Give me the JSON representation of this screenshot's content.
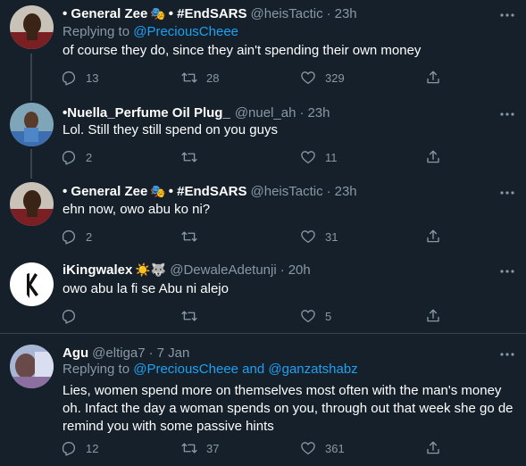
{
  "tweets": [
    {
      "name": "• General Zee",
      "emoji": "🎭",
      "name_suffix": "• #EndSARS",
      "handle": "@heisTactic",
      "time": "23h",
      "reply_prefix": "Replying to",
      "reply_to": "@PreciousCheee",
      "text": "of course they do, since they ain't spending their own money",
      "replies": "13",
      "retweets": "28",
      "likes": "329"
    },
    {
      "name": "•Nuella_Perfume Oil Plug_",
      "handle": "@nuel_ah",
      "time": "23h",
      "text": "Lol. Still they still spend on you guys",
      "replies": "2",
      "retweets": "",
      "likes": "11"
    },
    {
      "name": "• General Zee",
      "emoji": "🎭",
      "name_suffix": "• #EndSARS",
      "handle": "@heisTactic",
      "time": "23h",
      "text": "ehn now, owo abu ko ni?",
      "replies": "2",
      "retweets": "",
      "likes": "31"
    },
    {
      "name": "iKingwalex",
      "emoji": "☀️🐺",
      "handle": "@DewaleAdetunji",
      "time": "20h",
      "text": "owo abu la fi se Abu ni alejo",
      "replies": "",
      "retweets": "",
      "likes": "5"
    },
    {
      "name": "Agu",
      "handle": "@eltiga7",
      "time": "7 Jan",
      "reply_prefix": "Replying to",
      "reply_to": "@PreciousCheee and @ganzatshabz",
      "text_lines": [
        "Lies, women spend more on themselves most often with the man's money",
        "oh. Infact the day a woman spends on you, through out that week she go de",
        "remind you with some passive hints"
      ],
      "replies": "12",
      "retweets": "37",
      "likes": "361"
    }
  ],
  "separator": "·",
  "colors": {
    "background": "#15202b",
    "secondary": "#8899a6",
    "link": "#1da1f2",
    "border": "#38444d"
  }
}
